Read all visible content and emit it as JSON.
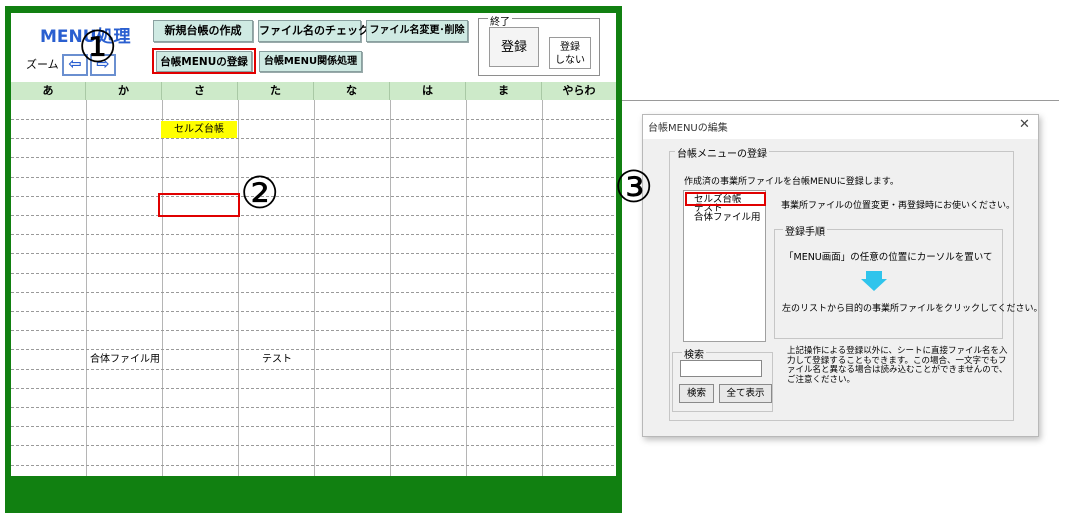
{
  "sheet": {
    "title": "MENU処理",
    "zoom_label": "ズーム",
    "zoom_out": "⇦",
    "zoom_in": "⇨",
    "buttons": {
      "new_ledger": "新規台帳の作成",
      "check_filename": "ファイル名のチェック",
      "rename_delete": "ファイル名変更･削除",
      "register_menu": "台帳MENUの登録",
      "menu_related": "台帳MENU関係処理"
    },
    "end_group": {
      "legend": "終了",
      "register": "登録",
      "no_register": "登録\nしない"
    },
    "columns": [
      "あ",
      "か",
      "さ",
      "た",
      "な",
      "は",
      "ま",
      "やらわ"
    ],
    "cells": {
      "sells_ledger": "セルズ台帳",
      "combined_file": "合体ファイル用",
      "test": "テスト"
    }
  },
  "callouts": [
    "①",
    "②",
    "③"
  ],
  "dialog": {
    "title": "台帳MENUの編集",
    "close": "✕",
    "group_legend": "台帳メニューの登録",
    "description": "作成済の事業所ファイルを台帳MENUに登録します。",
    "description2": "事業所ファイルの位置変更・再登録時にお使いください。",
    "list_items": [
      "セルズ台帳",
      "テスト",
      "合体ファイル用"
    ],
    "steps": {
      "legend": "登録手順",
      "step1": "「MENU画面」の任意の位置にカーソルを置いて",
      "step2": "左のリストから目的の事業所ファイルをクリックしてください。"
    },
    "search": {
      "legend": "検索",
      "value": "",
      "search_button": "検索",
      "show_all_button": "全て表示"
    },
    "note": "上記操作による登録以外に、シートに直接ファイル名を入力して登録することもできます。この場合、一文字でもファイル名と異なる場合は読み込むことができませんので、ご注意ください。"
  },
  "colors": {
    "frame_green": "#118011",
    "header_green": "#cdeac9",
    "button_teal": "#cfeae3",
    "highlight_yellow": "#ffff00",
    "annotation_red": "#e00000",
    "arrow_blue": "#2fc4ec"
  }
}
